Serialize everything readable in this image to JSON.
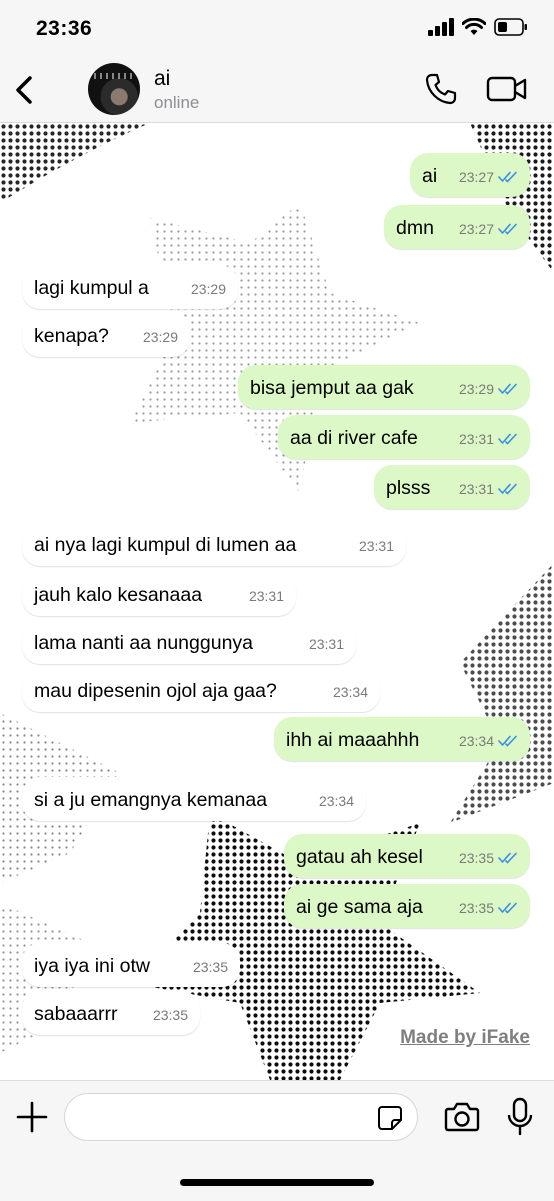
{
  "status_bar": {
    "time": "23:36"
  },
  "header": {
    "contact_name": "ai",
    "contact_status": "online"
  },
  "messages": [
    {
      "dir": "out",
      "text": "ai",
      "time": "23:27",
      "read": true
    },
    {
      "dir": "out",
      "text": "dmn",
      "time": "23:27",
      "read": true
    },
    {
      "dir": "in",
      "text": "lagi kumpul a",
      "time": "23:29"
    },
    {
      "dir": "in",
      "text": "kenapa?",
      "time": "23:29"
    },
    {
      "dir": "out",
      "text": "bisa jemput aa gak",
      "time": "23:29",
      "read": true
    },
    {
      "dir": "out",
      "text": "aa di river cafe",
      "time": "23:31",
      "read": true
    },
    {
      "dir": "out",
      "text": "plsss",
      "time": "23:31",
      "read": true
    },
    {
      "dir": "in",
      "text": "ai nya lagi kumpul di lumen aa",
      "time": "23:31"
    },
    {
      "dir": "in",
      "text": "jauh kalo kesanaaa",
      "time": "23:31"
    },
    {
      "dir": "in",
      "text": "lama nanti aa nunggunya",
      "time": "23:31"
    },
    {
      "dir": "in",
      "text": "mau dipesenin ojol aja gaa?",
      "time": "23:34"
    },
    {
      "dir": "out",
      "text": "ihh ai maaahhh",
      "time": "23:34",
      "read": true
    },
    {
      "dir": "in",
      "text": "si a ju emangnya kemanaa",
      "time": "23:34"
    },
    {
      "dir": "out",
      "text": "gatau ah kesel",
      "time": "23:35",
      "read": true
    },
    {
      "dir": "out",
      "text": "ai ge sama aja",
      "time": "23:35",
      "read": true
    },
    {
      "dir": "in",
      "text": "iya iya ini otw",
      "time": "23:35"
    },
    {
      "dir": "in",
      "text": "sabaaarrr",
      "time": "23:35"
    }
  ],
  "watermark": "Made by iFake",
  "composer": {
    "placeholder": ""
  },
  "colors": {
    "outgoing_bubble": "#dcf8c6",
    "incoming_bubble": "#ffffff",
    "read_tick": "#3b8fe0"
  }
}
